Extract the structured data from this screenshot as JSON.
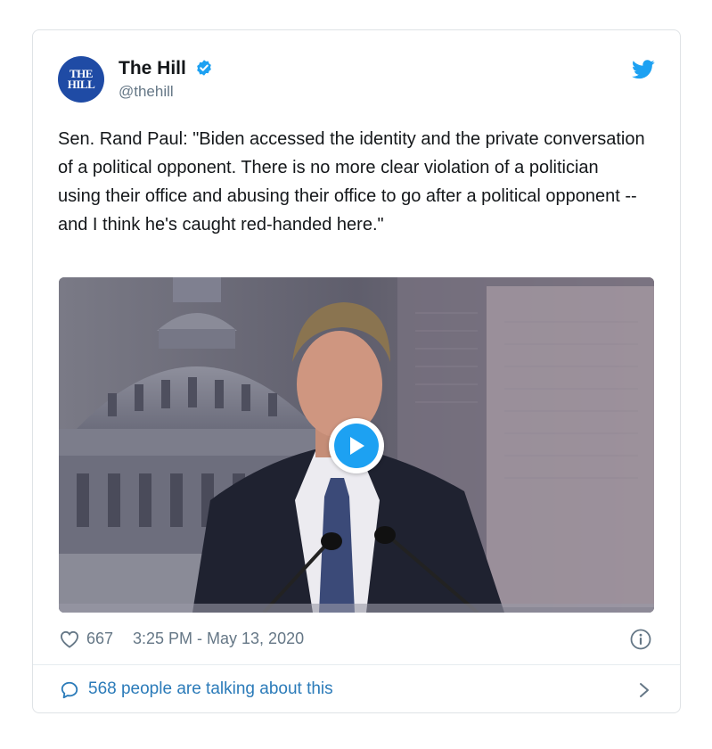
{
  "account": {
    "avatar_text_line1": "THE",
    "avatar_text_line2": "HILL",
    "display_name": "The Hill",
    "handle": "@thehill",
    "verified_icon": "verified-badge-icon"
  },
  "tweet": {
    "text": "Sen. Rand Paul: \"Biden accessed the identity and the private conversation of a political opponent. There is no more clear violation of a politician using their office and abusing their office to go after a political opponent -- and I think he's caught red-handed here.\""
  },
  "media": {
    "type": "video",
    "play_icon": "play-icon"
  },
  "meta": {
    "like_count": "667",
    "timestamp": "3:25 PM - May 13, 2020",
    "info_icon": "info-icon"
  },
  "footer": {
    "talking_label": "568 people are talking about this",
    "chevron_icon": "chevron-right-icon"
  },
  "colors": {
    "accent": "#1da1f2",
    "link": "#2b7bb9",
    "muted": "#657786",
    "avatar_bg": "#1f4ba5"
  }
}
